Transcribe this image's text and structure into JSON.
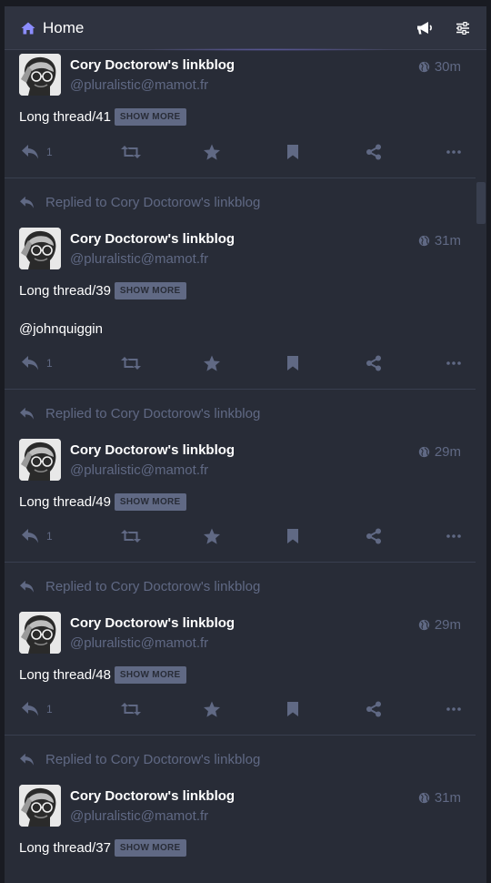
{
  "header": {
    "title": "Home"
  },
  "statuses": [
    {
      "prepend": "",
      "name": "Cory Doctorow's linkblog",
      "acct": "@pluralistic@mamot.fr",
      "time": "30m",
      "text": "Long thread/41",
      "show_more": "SHOW MORE",
      "mention": "",
      "replies": "1"
    },
    {
      "prepend": "Replied to Cory Doctorow's linkblog",
      "name": "Cory Doctorow's linkblog",
      "acct": "@pluralistic@mamot.fr",
      "time": "31m",
      "text": "Long thread/39",
      "show_more": "SHOW MORE",
      "mention": "@johnquiggin",
      "replies": "1"
    },
    {
      "prepend": "Replied to Cory Doctorow's linkblog",
      "name": "Cory Doctorow's linkblog",
      "acct": "@pluralistic@mamot.fr",
      "time": "29m",
      "text": "Long thread/49",
      "show_more": "SHOW MORE",
      "mention": "",
      "replies": "1"
    },
    {
      "prepend": "Replied to Cory Doctorow's linkblog",
      "name": "Cory Doctorow's linkblog",
      "acct": "@pluralistic@mamot.fr",
      "time": "29m",
      "text": "Long thread/48",
      "show_more": "SHOW MORE",
      "mention": "",
      "replies": "1"
    },
    {
      "prepend": "Replied to Cory Doctorow's linkblog",
      "name": "Cory Doctorow's linkblog",
      "acct": "@pluralistic@mamot.fr",
      "time": "31m",
      "text": "Long thread/37",
      "show_more": "SHOW MORE",
      "mention": "",
      "replies": ""
    }
  ],
  "colors": {
    "accent": "#8c8dff",
    "muted": "#606984",
    "column_bg": "#282c37"
  }
}
